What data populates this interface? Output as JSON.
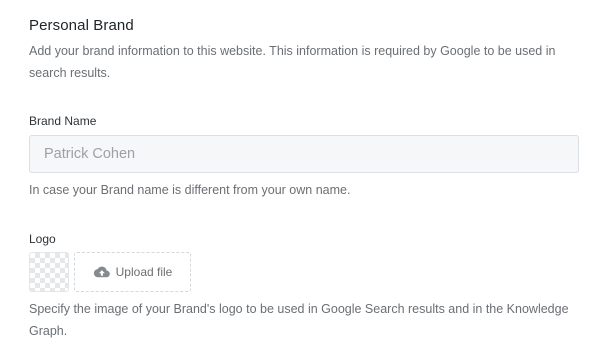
{
  "section": {
    "title": "Personal Brand",
    "description": "Add your brand information to this website. This information is required by Google to be used in search results."
  },
  "brand_name": {
    "label": "Brand Name",
    "placeholder": "Patrick Cohen",
    "value": "",
    "help": "In case your Brand name is different from your own name."
  },
  "logo": {
    "label": "Logo",
    "upload_label": "Upload file",
    "help": "Specify the image of your Brand's logo to be used in Google Search results and in the Knowledge Graph.",
    "upload_icon": "cloud-upload-icon",
    "thumb_icon": "transparent-image-placeholder"
  }
}
